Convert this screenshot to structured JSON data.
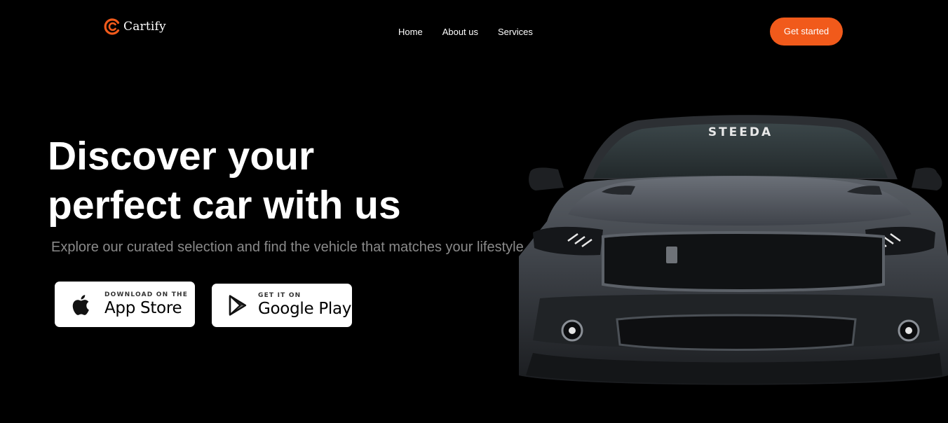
{
  "header": {
    "brand": "Cartify",
    "nav": [
      "Home",
      "About us",
      "Services"
    ],
    "cta_label": "Get started"
  },
  "hero": {
    "title_line1": "Discover your",
    "title_line2": "perfect car with us",
    "subtitle": "Explore our curated selection and find the vehicle that matches your lifestyle"
  },
  "badges": {
    "apple": {
      "small": "DOWNLOAD ON THE",
      "big": "App Store",
      "icon": "apple-icon"
    },
    "google": {
      "small": "GET IT ON",
      "big": "Google Play",
      "icon": "play-icon"
    }
  },
  "car": {
    "windshield_text": "STEEDA"
  },
  "colors": {
    "accent": "#f15a1b",
    "background": "#000000",
    "subtitle": "#8a8a8a"
  }
}
